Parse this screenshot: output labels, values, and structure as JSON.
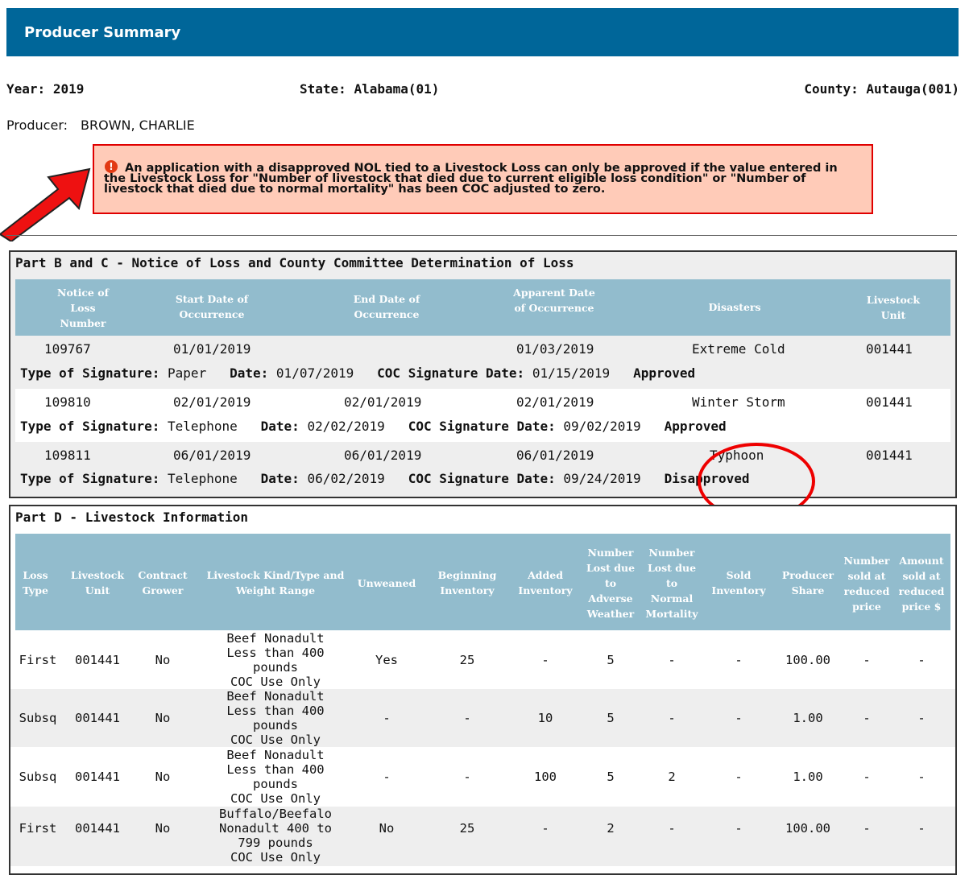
{
  "header": {
    "title": "Producer Summary",
    "color": "#006699"
  },
  "info": {
    "year_label": "Year:",
    "year": "2019",
    "state_label": "State:",
    "state": "Alabama(01)",
    "county_label": "County:",
    "county": "Autauga(001)",
    "producer_label": "Producer:",
    "producer": "BROWN, CHARLIE"
  },
  "warning": {
    "icon": "error-icon",
    "message": "An application with a disapproved NOL tied to a Livestock Loss can only be approved if the value entered in the Livestock Loss for \"Number of livestock that died due to current eligible loss condition\" or \"Number of livestock that died due to normal mortality\" has been COC adjusted to zero."
  },
  "part_bc": {
    "title": "Part B and C - Notice of Loss and County Committee Determination of Loss",
    "headers": {
      "nol": "Notice of Loss Number",
      "start": "Start Date of Occurrence",
      "end": "End Date of Occurrence",
      "apparent": "Apparent Date of Occurrence",
      "disasters": "Disasters",
      "unit": "Livestock Unit"
    },
    "labels": {
      "sig_type": "Type of Signature:",
      "date": "Date:",
      "coc_date": "COC Signature Date:"
    },
    "rows": [
      {
        "nol": "109767",
        "start": "01/01/2019",
        "end": "",
        "apparent": "01/03/2019",
        "disaster": "Extreme Cold",
        "unit": "001441",
        "sig_type": "Paper",
        "date": "01/07/2019",
        "coc_date": "01/15/2019",
        "status": "Approved"
      },
      {
        "nol": "109810",
        "start": "02/01/2019",
        "end": "02/01/2019",
        "apparent": "02/01/2019",
        "disaster": "Winter Storm",
        "unit": "001441",
        "sig_type": "Telephone",
        "date": "02/02/2019",
        "coc_date": "09/02/2019",
        "status": "Approved"
      },
      {
        "nol": "109811",
        "start": "06/01/2019",
        "end": "06/01/2019",
        "apparent": "06/01/2019",
        "disaster": "Typhoon",
        "unit": "001441",
        "sig_type": "Telephone",
        "date": "06/02/2019",
        "coc_date": "09/24/2019",
        "status": "Disapproved"
      }
    ]
  },
  "part_d": {
    "title": "Part D - Livestock Information",
    "headers": {
      "loss_type": "Loss Type",
      "unit": "Livestock Unit",
      "contract": "Contract Grower",
      "kind": "Livestock Kind/Type and Weight Range",
      "unweaned": "Unweaned",
      "beginning": "Beginning Inventory",
      "added": "Added Inventory",
      "lost_adverse": "Number Lost due to Adverse Weather",
      "lost_normal": "Number Lost due to Normal Mortality",
      "sold": "Sold Inventory",
      "share": "Producer Share",
      "sold_reduced": "Number sold at reduced price",
      "amount_reduced": "Amount sold at reduced price $"
    },
    "rows": [
      {
        "loss_type": "First",
        "unit": "001441",
        "contract": "No",
        "kind": [
          "Beef   Nonadult",
          "Less than 400",
          "pounds",
          "COC Use Only"
        ],
        "unweaned": "Yes",
        "beginning": "25",
        "added": "-",
        "lost_adverse": "5",
        "lost_normal": "-",
        "sold": "-",
        "share": "100.00",
        "sold_reduced": "-",
        "amount_reduced": "-"
      },
      {
        "loss_type": "Subsq",
        "unit": "001441",
        "contract": "No",
        "kind": [
          "Beef   Nonadult",
          "Less than 400",
          "pounds",
          "COC Use Only"
        ],
        "unweaned": "-",
        "beginning": "-",
        "added": "10",
        "lost_adverse": "5",
        "lost_normal": "-",
        "sold": "-",
        "share": "1.00",
        "sold_reduced": "-",
        "amount_reduced": "-"
      },
      {
        "loss_type": "Subsq",
        "unit": "001441",
        "contract": "No",
        "kind": [
          "Beef   Nonadult",
          "Less than 400",
          "pounds",
          "COC Use Only"
        ],
        "unweaned": "-",
        "beginning": "-",
        "added": "100",
        "lost_adverse": "5",
        "lost_normal": "2",
        "sold": "-",
        "share": "1.00",
        "sold_reduced": "-",
        "amount_reduced": "-"
      },
      {
        "loss_type": "First",
        "unit": "001441",
        "contract": "No",
        "kind": [
          "Buffalo/Beefalo",
          "Nonadult   400 to",
          "799 pounds",
          "COC Use Only"
        ],
        "unweaned": "No",
        "beginning": "25",
        "added": "-",
        "lost_adverse": "2",
        "lost_normal": "-",
        "sold": "-",
        "share": "100.00",
        "sold_reduced": "-",
        "amount_reduced": "-"
      }
    ]
  },
  "annotations": {
    "arrow_color": "#ee1111",
    "circle_color": "#ee0000"
  }
}
